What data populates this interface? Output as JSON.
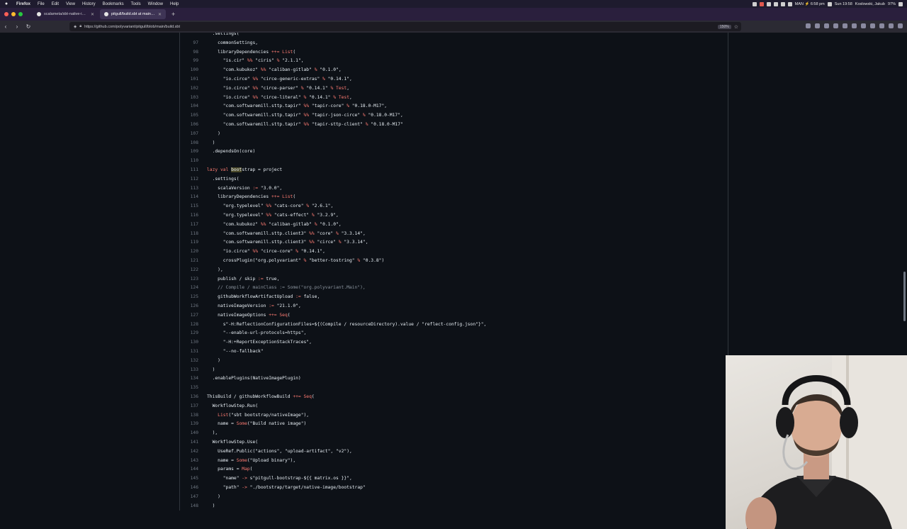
{
  "menubar": {
    "app": "Firefox",
    "items": [
      "File",
      "Edit",
      "View",
      "History",
      "Bookmarks",
      "Tools",
      "Window",
      "Help"
    ],
    "status_battery": "MAN ⚡ 6:58 pm",
    "clock": "Sun 19:58",
    "user": "Koslowski, Jakub",
    "battery_pct": "97%"
  },
  "tabs": [
    {
      "title": "scalameta/sbt-native-image: P..."
    },
    {
      "title": "pitgull/build.sbt at main · polyv..."
    }
  ],
  "navbar": {
    "url": "https://github.com/polyvariant/pitgull/blob/main/build.sbt",
    "zoom": "150%"
  },
  "code": {
    "lines": [
      {
        "n": "",
        "t": "  .settings("
      },
      {
        "n": "97",
        "t": "    commonSettings,"
      },
      {
        "n": "98",
        "t": "    libraryDependencies ++= List("
      },
      {
        "n": "99",
        "t": "      \"is.cir\" %% \"ciris\" % \"2.1.1\","
      },
      {
        "n": "100",
        "t": "      \"com.kubukoz\" %% \"caliban-gitlab\" % \"0.1.0\","
      },
      {
        "n": "101",
        "t": "      \"io.circe\" %% \"circe-generic-extras\" % \"0.14.1\","
      },
      {
        "n": "102",
        "t": "      \"io.circe\" %% \"circe-parser\" % \"0.14.1\" % Test,"
      },
      {
        "n": "103",
        "t": "      \"io.circe\" %% \"circe-literal\" % \"0.14.1\" % Test,"
      },
      {
        "n": "104",
        "t": "      \"com.softwaremill.sttp.tapir\" %% \"tapir-core\" % \"0.18.0-M17\","
      },
      {
        "n": "105",
        "t": "      \"com.softwaremill.sttp.tapir\" %% \"tapir-json-circe\" % \"0.18.0-M17\","
      },
      {
        "n": "106",
        "t": "      \"com.softwaremill.sttp.tapir\" %% \"tapir-sttp-client\" % \"0.18.0-M17\""
      },
      {
        "n": "107",
        "t": "    )"
      },
      {
        "n": "108",
        "t": "  )"
      },
      {
        "n": "109",
        "t": "  .dependsOn(core)"
      },
      {
        "n": "110",
        "t": ""
      },
      {
        "n": "111",
        "t": "lazy val bootstrap = project",
        "hl": "boot"
      },
      {
        "n": "112",
        "t": "  .settings("
      },
      {
        "n": "113",
        "t": "    scalaVersion := \"3.0.0\","
      },
      {
        "n": "114",
        "t": "    libraryDependencies ++= List("
      },
      {
        "n": "115",
        "t": "      \"org.typelevel\" %% \"cats-core\" % \"2.6.1\","
      },
      {
        "n": "116",
        "t": "      \"org.typelevel\" %% \"cats-effect\" % \"3.2.9\","
      },
      {
        "n": "117",
        "t": "      \"com.kubukoz\" %% \"caliban-gitlab\" % \"0.1.0\","
      },
      {
        "n": "118",
        "t": "      \"com.softwaremill.sttp.client3\" %% \"core\" % \"3.3.14\","
      },
      {
        "n": "119",
        "t": "      \"com.softwaremill.sttp.client3\" %% \"circe\" % \"3.3.14\","
      },
      {
        "n": "120",
        "t": "      \"io.circe\" %% \"circe-core\" % \"0.14.1\","
      },
      {
        "n": "121",
        "t": "      crossPlugin(\"org.polyvariant\" % \"better-tostring\" % \"0.3.8\")"
      },
      {
        "n": "122",
        "t": "    ),"
      },
      {
        "n": "123",
        "t": "    publish / skip := true,"
      },
      {
        "n": "124",
        "t": "    // Compile / mainClass := Some(\"org.polyvariant.Main\"),"
      },
      {
        "n": "125",
        "t": "    githubWorkflowArtifactUpload := false,"
      },
      {
        "n": "126",
        "t": "    nativeImageVersion := \"21.1.0\","
      },
      {
        "n": "127",
        "t": "    nativeImageOptions ++= Seq("
      },
      {
        "n": "128",
        "t": "      s\"-H:ReflectionConfigurationFiles=${(Compile / resourceDirectory).value / \"reflect-config.json\"}\","
      },
      {
        "n": "129",
        "t": "      \"--enable-url-protocols=https\","
      },
      {
        "n": "130",
        "t": "      \"-H:+ReportExceptionStackTraces\","
      },
      {
        "n": "131",
        "t": "      \"--no-fallback\""
      },
      {
        "n": "132",
        "t": "    )"
      },
      {
        "n": "133",
        "t": "  )"
      },
      {
        "n": "134",
        "t": "  .enablePlugins(NativeImagePlugin)"
      },
      {
        "n": "135",
        "t": ""
      },
      {
        "n": "136",
        "t": "ThisBuild / githubWorkflowBuild ++= Seq("
      },
      {
        "n": "137",
        "t": "  WorkflowStep.Run("
      },
      {
        "n": "138",
        "t": "    List(\"sbt bootstrap/nativeImage\"),"
      },
      {
        "n": "139",
        "t": "    name = Some(\"Build native image\")"
      },
      {
        "n": "140",
        "t": "  ),"
      },
      {
        "n": "141",
        "t": "  WorkflowStep.Use("
      },
      {
        "n": "142",
        "t": "    UseRef.Public(\"actions\", \"upload-artifact\", \"v2\"),"
      },
      {
        "n": "143",
        "t": "    name = Some(\"Upload binary\"),"
      },
      {
        "n": "144",
        "t": "    params = Map("
      },
      {
        "n": "145",
        "t": "      \"name\" -> s\"pitgull-bootstrap-${{ matrix.os }}\","
      },
      {
        "n": "146",
        "t": "      \"path\" -> \"./bootstrap/target/native-image/bootstrap\""
      },
      {
        "n": "147",
        "t": "    )"
      },
      {
        "n": "148",
        "t": "  )"
      },
      {
        "n": "",
        "t": ")"
      }
    ]
  },
  "colors": {
    "string": "#e6edf3",
    "keyword": "#ff7b72",
    "operator": "#ff7b72",
    "comment": "#8b949e",
    "type": "#d2a8ff"
  }
}
